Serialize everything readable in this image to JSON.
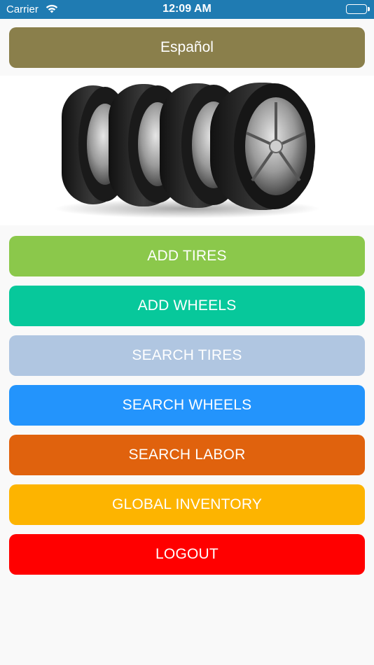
{
  "status_bar": {
    "carrier": "Carrier",
    "time": "12:09 AM",
    "battery_level": 1.0
  },
  "language_button": {
    "label": "Español",
    "color": "#8a7f4b"
  },
  "hero_image": {
    "subject": "four tires on alloy wheels"
  },
  "menu": {
    "add_tires": {
      "label": "ADD TIRES",
      "color": "#8bc84b"
    },
    "add_wheels": {
      "label": "ADD WHEELS",
      "color": "#07c89b"
    },
    "search_tires": {
      "label": "SEARCH TIRES",
      "color": "#b0c6e1"
    },
    "search_wheels": {
      "label": "SEARCH WHEELS",
      "color": "#2394fc"
    },
    "search_labor": {
      "label": "SEARCH LABOR",
      "color": "#e0620d"
    },
    "global_inventory": {
      "label": "GLOBAL INVENTORY",
      "color": "#fdb400"
    },
    "logout": {
      "label": "LOGOUT",
      "color": "#ff0000"
    }
  },
  "icons": {
    "wifi": "wifi-icon",
    "battery": "battery-icon"
  }
}
